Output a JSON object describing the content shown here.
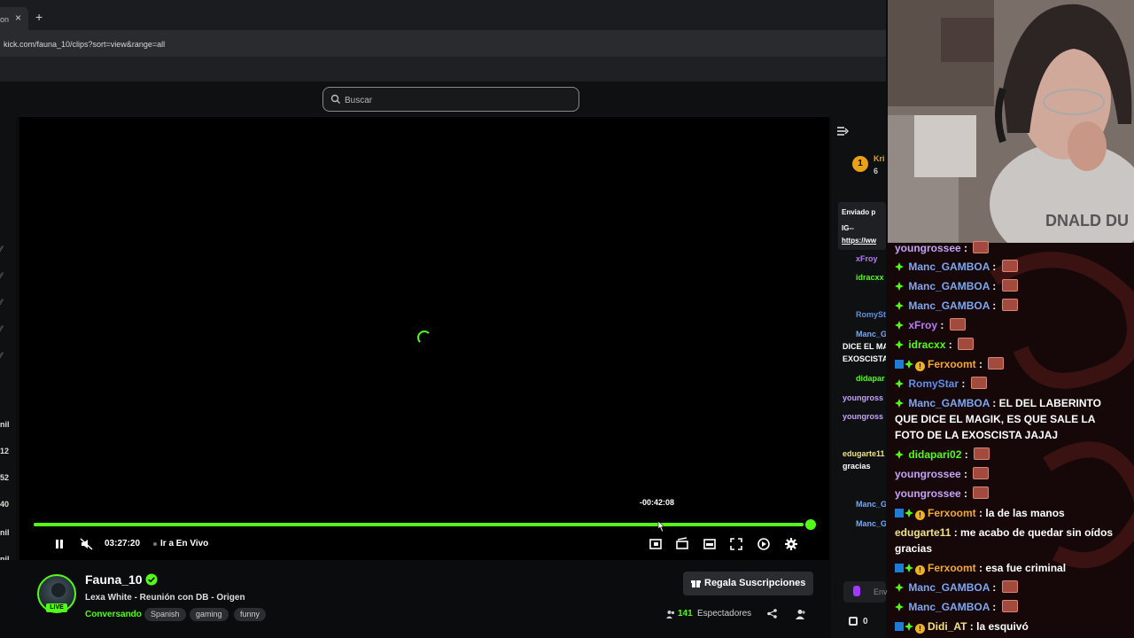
{
  "browser": {
    "tab_label": "on",
    "tab_close": "×",
    "new_tab": "+",
    "url": "kick.com/fauna_10/clips?sort=view&range=all"
  },
  "search": {
    "placeholder": "Buscar"
  },
  "sidebar_left": {
    "numbers": [
      "nil",
      "12",
      "52",
      "40",
      "nil",
      "nil",
      "nil",
      "nil"
    ]
  },
  "player": {
    "hover_time": "-00:42:08",
    "timecode": "03:27:20",
    "go_live_label": "Ir a En Vivo",
    "progress_fraction": 0.99,
    "accent_color": "#53fc18"
  },
  "stream": {
    "channel": "Fauna_10",
    "live_label": "LIVE",
    "title": "Lexa White - Reunión con DB - Origen",
    "category": "Conversando",
    "tags": [
      "Spanish",
      "gaming",
      "funny"
    ],
    "subs_button": "Regala Suscripciones",
    "viewers_count": "141",
    "viewers_label": "Espectadores"
  },
  "page_chat": {
    "top_user": "Kri",
    "top_user_sub": "6",
    "rank": "1",
    "pinned_header": "Enviado p",
    "pinned_line1": "IG--",
    "pinned_line2": "https://ww",
    "items": [
      {
        "text": "xFroy",
        "color": "#b87cf5"
      },
      {
        "text": "idracxx",
        "color": "#53fc18"
      },
      {
        "text": "RomySt",
        "color": "#5f8fe8"
      },
      {
        "text": "Manc_G",
        "color": "#7ea7f0"
      },
      {
        "text": "DICE EL MA",
        "color": "#ffffff"
      },
      {
        "text": "EXOSCISTA",
        "color": "#ffffff"
      },
      {
        "text": "didapar",
        "color": "#53fc18"
      },
      {
        "text": "youngross",
        "color": "#c5a3f7"
      },
      {
        "text": "youngross",
        "color": "#c5a3f7"
      },
      {
        "text": "edugarte11",
        "color": "#f0e08a"
      },
      {
        "text": "gracias",
        "color": "#ffffff"
      },
      {
        "text": "Manc_G",
        "color": "#7ea7f0"
      },
      {
        "text": "Manc_G",
        "color": "#7ea7f0"
      }
    ],
    "send_placeholder": "Env",
    "footer_count": "0"
  },
  "overlay_chat": {
    "messages": [
      {
        "user": "youngrossee",
        "color": "#c5a3f7",
        "text": "",
        "emote": true,
        "gem": false,
        "badges": false
      },
      {
        "user": "Manc_GAMBOA",
        "color": "#7ea7f0",
        "text": "",
        "emote": true,
        "gem": true,
        "badges": false
      },
      {
        "user": "Manc_GAMBOA",
        "color": "#7ea7f0",
        "text": "",
        "emote": true,
        "gem": true,
        "badges": false
      },
      {
        "user": "Manc_GAMBOA",
        "color": "#7ea7f0",
        "text": "",
        "emote": true,
        "gem": true,
        "badges": false
      },
      {
        "user": "xFroy",
        "color": "#b87cf5",
        "text": "",
        "emote": true,
        "gem": true,
        "badges": false
      },
      {
        "user": "idracxx",
        "color": "#53fc18",
        "text": "",
        "emote": true,
        "gem": true,
        "badges": false
      },
      {
        "user": "Ferxoomt",
        "color": "#f0a83a",
        "text": "",
        "emote": true,
        "gem": false,
        "badges": true
      },
      {
        "user": "RomyStar",
        "color": "#5f8fe8",
        "text": "",
        "emote": true,
        "gem": true,
        "badges": false
      },
      {
        "user": "Manc_GAMBOA",
        "color": "#7ea7f0",
        "text": "EL DEL LABERINTO QUE DICE EL MAGIK, ES QUE SALE LA FOTO DE LA EXOSCISTA JAJAJ",
        "emote": false,
        "gem": true,
        "badges": false
      },
      {
        "user": "didapari02",
        "color": "#53fc18",
        "text": "",
        "emote": true,
        "gem": true,
        "badges": false
      },
      {
        "user": "youngrossee",
        "color": "#c5a3f7",
        "text": "",
        "emote": true,
        "gem": false,
        "badges": false
      },
      {
        "user": "youngrossee",
        "color": "#c5a3f7",
        "text": "",
        "emote": true,
        "gem": false,
        "badges": false
      },
      {
        "user": "Ferxoomt",
        "color": "#f0a83a",
        "text": "la de las manos",
        "emote": false,
        "gem": false,
        "badges": true
      },
      {
        "user": "edugarte11",
        "color": "#f0e08a",
        "text": "me acabo de quedar sin oídos gracias",
        "emote": false,
        "gem": false,
        "badges": false
      },
      {
        "user": "Ferxoomt",
        "color": "#f0a83a",
        "text": "esa fue criminal",
        "emote": false,
        "gem": false,
        "badges": true
      },
      {
        "user": "Manc_GAMBOA",
        "color": "#7ea7f0",
        "text": "",
        "emote": true,
        "gem": true,
        "badges": false
      },
      {
        "user": "Manc_GAMBOA",
        "color": "#7ea7f0",
        "text": "",
        "emote": true,
        "gem": true,
        "badges": false
      },
      {
        "user": "Didi_AT",
        "color": "#f0e08a",
        "text": "la esquivó",
        "emote": false,
        "gem": false,
        "badges": true
      }
    ]
  }
}
